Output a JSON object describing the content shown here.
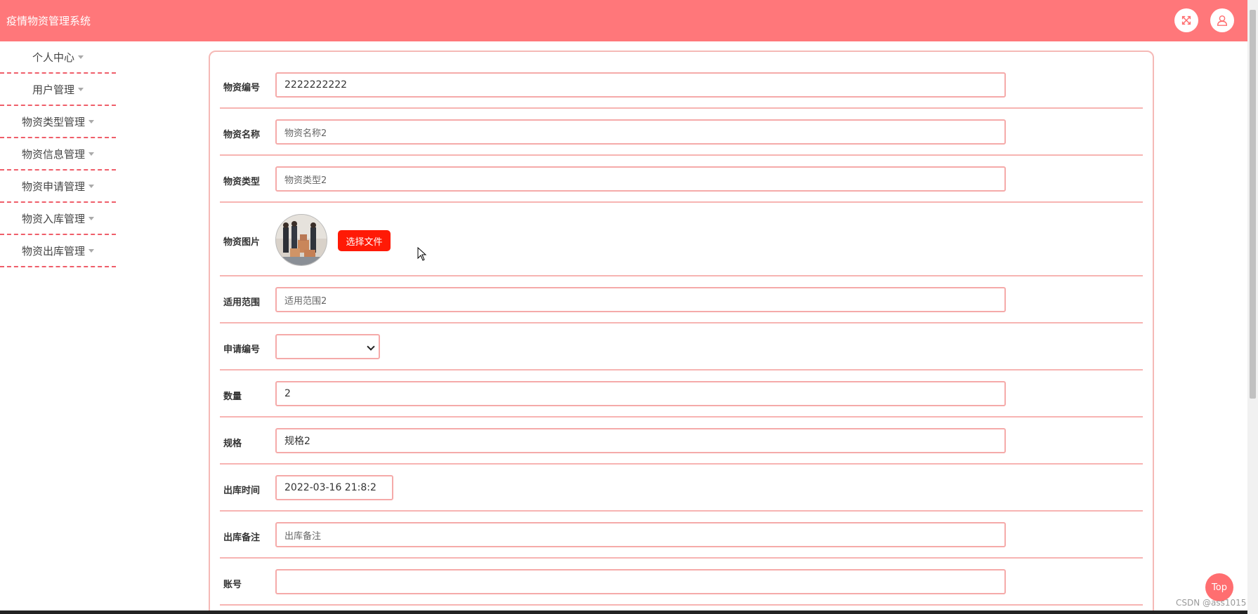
{
  "app": {
    "title": "疫情物资管理系统"
  },
  "header": {
    "fullscreen_icon": "fullscreen-icon",
    "user_icon": "user-icon"
  },
  "sidebar": {
    "items": [
      {
        "label": "个人中心"
      },
      {
        "label": "用户管理"
      },
      {
        "label": "物资类型管理"
      },
      {
        "label": "物资信息管理"
      },
      {
        "label": "物资申请管理"
      },
      {
        "label": "物资入库管理"
      },
      {
        "label": "物资出库管理"
      }
    ]
  },
  "form": {
    "material_code": {
      "label": "物资编号",
      "value": "2222222222"
    },
    "material_name": {
      "label": "物资名称",
      "value": "物资名称2"
    },
    "material_type": {
      "label": "物资类型",
      "value": "物资类型2"
    },
    "material_image": {
      "label": "物资图片",
      "button": "选择文件"
    },
    "scope": {
      "label": "适用范围",
      "value": "适用范围2"
    },
    "apply_no": {
      "label": "申请编号",
      "value": ""
    },
    "quantity": {
      "label": "数量",
      "value": "2"
    },
    "spec": {
      "label": "规格",
      "value": "规格2"
    },
    "outbound_time": {
      "label": "出库时间",
      "value": "2022-03-16 21:8:2"
    },
    "outbound_note": {
      "label": "出库备注",
      "placeholder": "出库备注"
    },
    "account": {
      "label": "账号",
      "value": ""
    }
  },
  "top_button": {
    "label": "Top"
  },
  "watermark": {
    "text": "CSDN @ass1015"
  },
  "colors": {
    "header": "#ff777a",
    "accent_border": "#f5aaa9",
    "file_button": "#ff1a06",
    "dashed_divider": "#ef5e6a"
  }
}
